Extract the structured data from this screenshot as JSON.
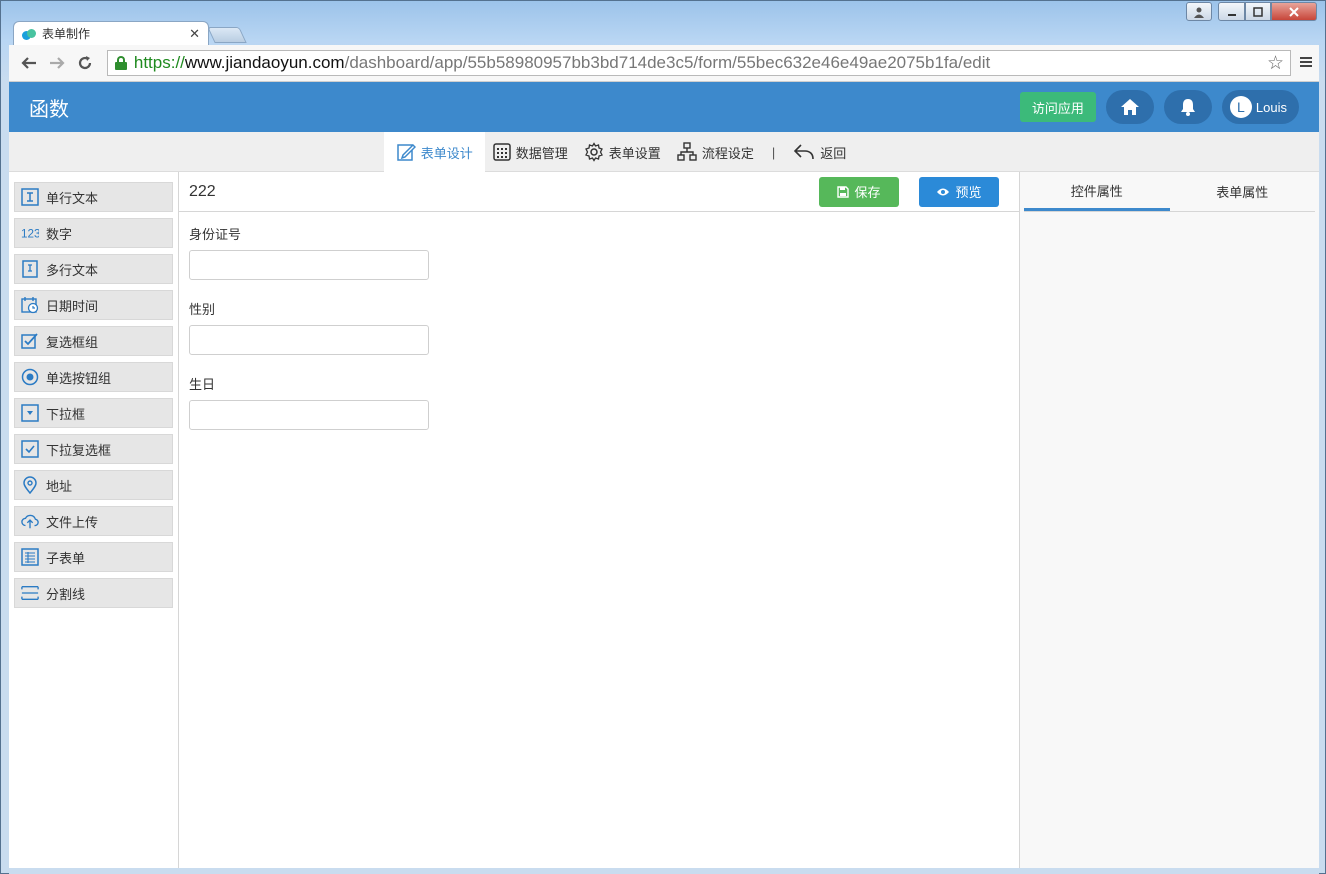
{
  "browser": {
    "tab_title": "表单制作",
    "url_scheme": "https://",
    "url_host": "www.jiandaoyun.com",
    "url_path": "/dashboard/app/55b58980957bb3bd714de3c5/form/55bec632e46e49ae2075b1fa/edit"
  },
  "header": {
    "app_title": "函数",
    "visit_label": "访问应用",
    "user_initial": "L",
    "user_name": "Louis"
  },
  "subnav": {
    "items": [
      {
        "label": "表单设计",
        "icon": "edit-icon",
        "active": true
      },
      {
        "label": "数据管理",
        "icon": "grid-icon"
      },
      {
        "label": "表单设置",
        "icon": "gear-icon"
      },
      {
        "label": "流程设定",
        "icon": "flow-icon"
      }
    ],
    "separator": "|",
    "back_label": "返回"
  },
  "palette": {
    "items": [
      {
        "label": "单行文本",
        "icon": "text-icon"
      },
      {
        "label": "数字",
        "icon": "number-icon"
      },
      {
        "label": "多行文本",
        "icon": "textarea-icon"
      },
      {
        "label": "日期时间",
        "icon": "calendar-icon"
      },
      {
        "label": "复选框组",
        "icon": "checkbox-icon"
      },
      {
        "label": "单选按钮组",
        "icon": "radio-icon"
      },
      {
        "label": "下拉框",
        "icon": "dropdown-icon"
      },
      {
        "label": "下拉复选框",
        "icon": "dropdown-check-icon"
      },
      {
        "label": "地址",
        "icon": "location-icon"
      },
      {
        "label": "文件上传",
        "icon": "upload-icon"
      },
      {
        "label": "子表单",
        "icon": "subform-icon"
      },
      {
        "label": "分割线",
        "icon": "divider-icon"
      }
    ]
  },
  "form": {
    "name": "222",
    "save_label": "保存",
    "preview_label": "预览",
    "fields": [
      {
        "label": "身份证号",
        "value": ""
      },
      {
        "label": "性别",
        "value": ""
      },
      {
        "label": "生日",
        "value": ""
      }
    ]
  },
  "props": {
    "tab_control": "控件属性",
    "tab_form": "表单属性"
  },
  "colors": {
    "brand": "#3d89cc",
    "save": "#56b85a",
    "preview": "#2b8ad8",
    "visit": "#3cba7a"
  }
}
